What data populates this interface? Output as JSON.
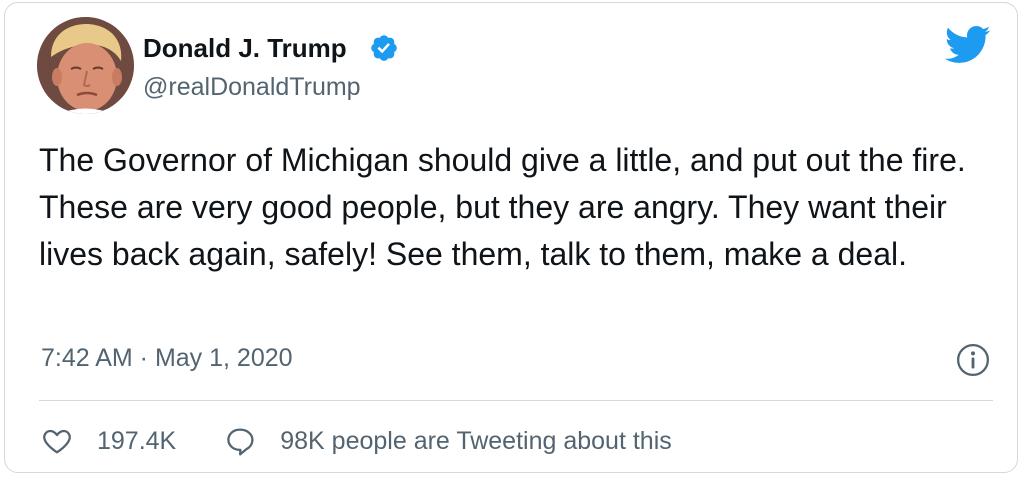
{
  "author": {
    "name": "Donald J. Trump",
    "handle": "@realDonaldTrump"
  },
  "tweet": {
    "text": "The Governor of Michigan should give a little, and put out the fire. These are very good people, but they are angry. They want their lives back again, safely! See them, talk to them, make a deal.",
    "timestamp": "7:42 AM · May 1, 2020"
  },
  "stats": {
    "likes": "197.4K",
    "tweeting": "98K people are Tweeting about this"
  },
  "colors": {
    "brand": "#1d9bf0",
    "text": "#0f1419",
    "muted": "#536471",
    "border": "#cfd9de"
  },
  "icons": {
    "verified": "verified-badge-icon",
    "brand": "twitter-bird-icon",
    "info": "info-icon",
    "like": "heart-icon",
    "reply": "speech-bubble-icon"
  }
}
